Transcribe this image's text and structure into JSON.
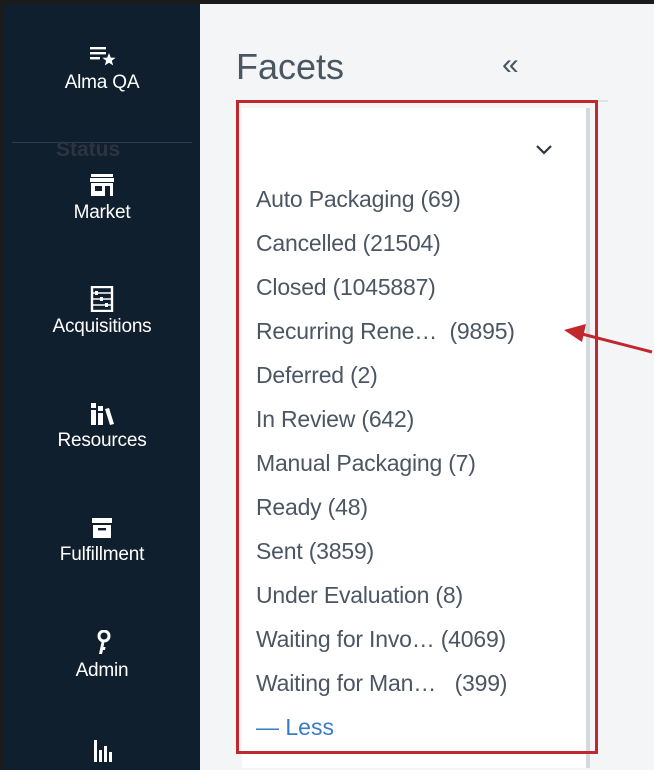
{
  "nav": {
    "org": "Alma QA",
    "items": [
      {
        "label": "Market",
        "icon": "store-icon"
      },
      {
        "label": "Acquisitions",
        "icon": "abacus-icon"
      },
      {
        "label": "Resources",
        "icon": "books-icon"
      },
      {
        "label": "Fulfillment",
        "icon": "archive-box-icon"
      },
      {
        "label": "Admin",
        "icon": "key-icon"
      },
      {
        "label": "",
        "icon": "analytics-icon"
      }
    ]
  },
  "facets": {
    "title": "Facets",
    "collapse_glyph": "«",
    "status": {
      "heading": "Status",
      "items": [
        {
          "label": "Auto Packaging (69)"
        },
        {
          "label": "Cancelled (21504)"
        },
        {
          "label": "Closed (1045887)"
        },
        {
          "label": "Recurring Rene…  (9895)"
        },
        {
          "label": "Deferred (2)"
        },
        {
          "label": "In Review (642)"
        },
        {
          "label": "Manual Packaging (7)"
        },
        {
          "label": "Ready (48)"
        },
        {
          "label": "Sent (3859)"
        },
        {
          "label": "Under Evaluation (8)"
        },
        {
          "label": "Waiting for Invo… (4069)"
        },
        {
          "label": "Waiting for Man…   (399)"
        }
      ],
      "less_label": "— Less"
    }
  },
  "colors": {
    "nav_bg": "#0f1f2e",
    "highlight": "#c0282e",
    "link": "#3a7bc6"
  }
}
